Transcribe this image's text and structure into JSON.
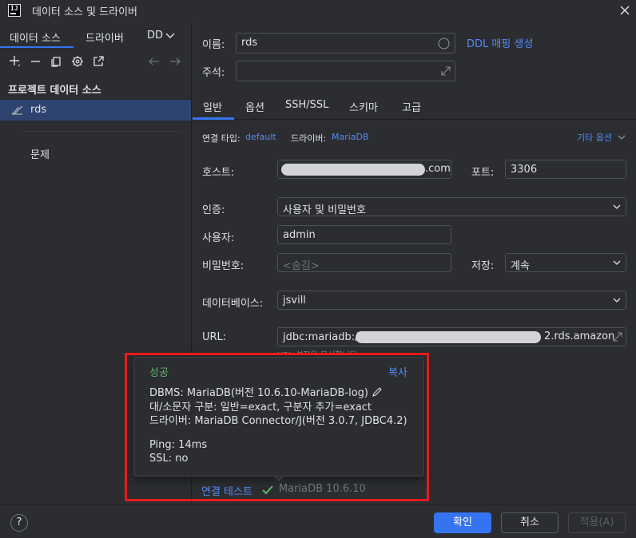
{
  "window": {
    "title": "데이터 소스 및 드라이버"
  },
  "left": {
    "tabs": {
      "data_sources": "데이터 소스",
      "drivers": "드라이버",
      "more": "DD"
    },
    "section_header": "프로젝트 데이터 소스",
    "items": [
      {
        "label": "rds"
      }
    ],
    "problems": "문제"
  },
  "form": {
    "name_label": "이름:",
    "name_value": "rds",
    "ddl_link": "DDL 매핑 생성",
    "comment_label": "주석:",
    "tabs": [
      "일반",
      "옵션",
      "SSH/SSL",
      "스키마",
      "고급"
    ],
    "conn_type_label": "연결 타입:",
    "conn_type_value": "default",
    "driver_label": "드라이버:",
    "driver_value": "MariaDB",
    "more_options": "기타 옵션",
    "host_label": "호스트:",
    "host_suffix": ".com",
    "port_label": "포트:",
    "port_value": "3306",
    "auth_label": "인증:",
    "auth_value": "사용자 및 비밀번호",
    "user_label": "사용자:",
    "user_value": "admin",
    "password_label": "비밀번호:",
    "password_placeholder": "<숨김>",
    "save_label": "저장:",
    "save_value": "계속",
    "database_label": "데이터베이스:",
    "database_value": "jsvill",
    "url_label": "URL:",
    "url_prefix": "jdbc:mariadb://",
    "url_suffix": "2.rds.amazon",
    "url_hint": "URL 설정을 무시합니다"
  },
  "popup": {
    "title": "성공",
    "copy": "복사",
    "lines": [
      "DBMS: MariaDB(버전 10.6.10-MariaDB-log)",
      "대/소문자 구분: 일반=exact, 구분자 추가=exact",
      "드라이버: MariaDB Connector/J(버전 3.0.7, JDBC4.2)",
      "Ping: 14ms",
      "SSL: no"
    ]
  },
  "test": {
    "label": "연결 테스트",
    "version": "MariaDB 10.6.10"
  },
  "buttons": {
    "help": "?",
    "ok": "확인",
    "cancel": "취소",
    "apply": "적용(A)"
  },
  "colors": {
    "accent": "#3574f0",
    "link": "#548af7",
    "success": "#5fb865",
    "highlight": "#e81b1b",
    "background": "#2b2d30"
  }
}
